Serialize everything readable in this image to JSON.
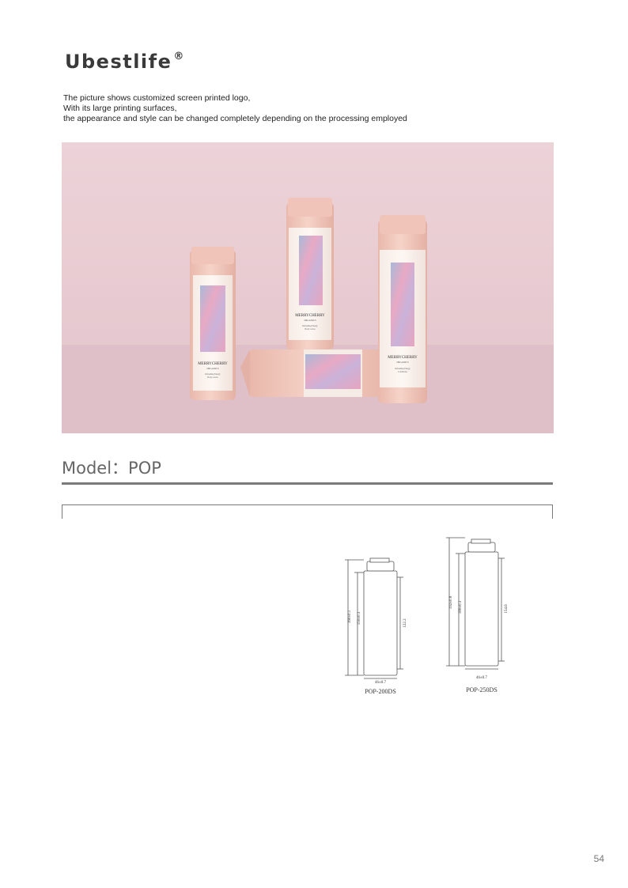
{
  "brand": {
    "name": "Ubestlife",
    "mark": "®"
  },
  "description": [
    "The picture shows customized screen printed logo,",
    "With its large printing surfaces,",
    "the appearance and style can be changed completely depending on the processing employed"
  ],
  "product_labels": {
    "brand": "MERRYCHERRY",
    "sub": "ORGANICS",
    "left_line1": "Refreshing Energy",
    "left_line2": "Body Lotion",
    "center_line1": "Refreshing Energy",
    "center_line2": "Body Lotion",
    "right_line1": "Refreshing Energy",
    "right_line2": "Conditioner"
  },
  "model": {
    "label": "Model：POP"
  },
  "drawings": [
    {
      "name": "POP-200DS",
      "width_dim": "46±0.7",
      "total_height": "160±0.1",
      "body_height": "150±0.3",
      "label_height": "122.2"
    },
    {
      "name": "POP-250DS",
      "width_dim": "46±0.7",
      "total_height": "192±0.8",
      "body_height": "180±0.3",
      "label_height": "154.6"
    }
  ],
  "page_number": "54",
  "colors": {
    "backdrop": "#e8cdd3",
    "bottle": "#f1c9bd",
    "rule": "#7a7a7a"
  }
}
